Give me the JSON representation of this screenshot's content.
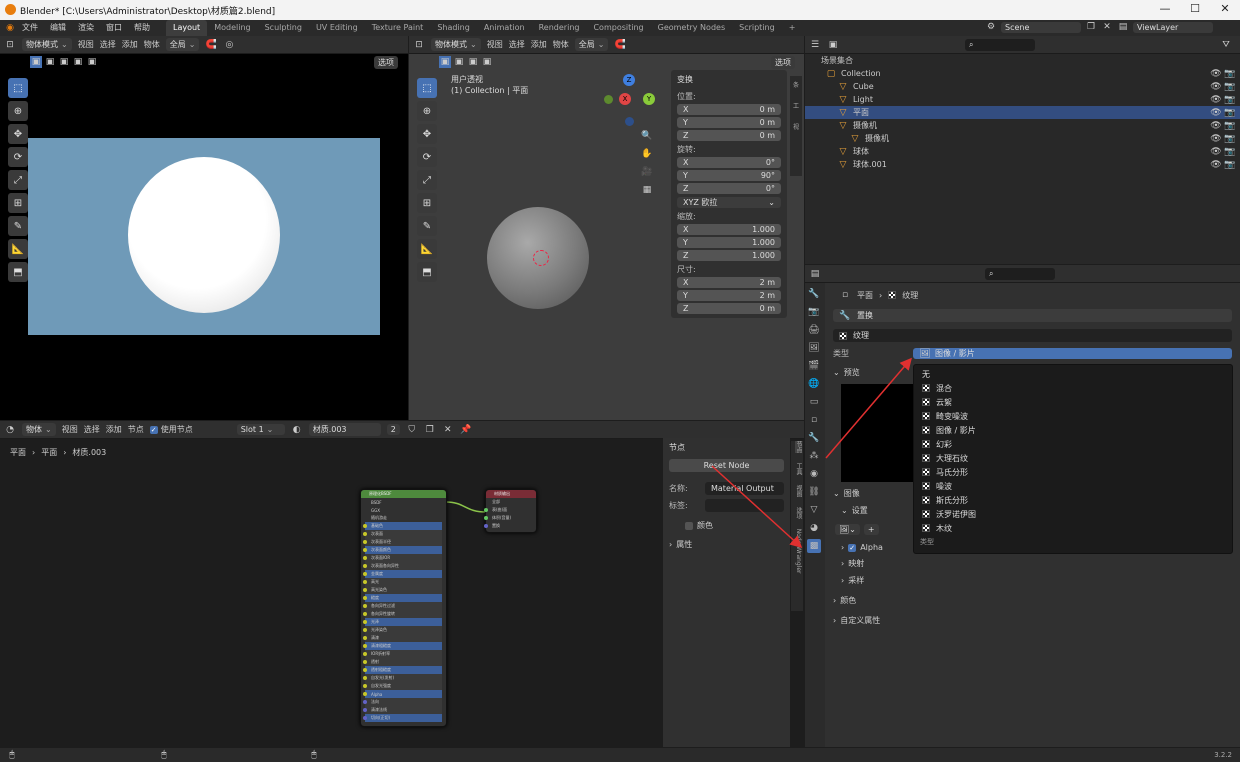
{
  "window": {
    "title": "Blender* [C:\\Users\\Administrator\\Desktop\\材质篇2.blend]",
    "minimize": "—",
    "maximize": "☐",
    "close": "✕"
  },
  "menu": [
    "文件",
    "编辑",
    "渲染",
    "窗口",
    "帮助"
  ],
  "workspaces": [
    "Layout",
    "Modeling",
    "Sculpting",
    "UV Editing",
    "Texture Paint",
    "Shading",
    "Animation",
    "Rendering",
    "Compositing",
    "Geometry Nodes",
    "Scripting",
    "+"
  ],
  "scene": {
    "scene_name": "Scene",
    "view_layer": "ViewLayer"
  },
  "viewport_left": {
    "mode": "物体模式",
    "menus": [
      "视图",
      "选择",
      "添加",
      "物体"
    ],
    "transform": "全局",
    "options": "选项"
  },
  "viewport_right": {
    "mode": "物体模式",
    "menus": [
      "视图",
      "选择",
      "添加",
      "物体"
    ],
    "transform": "全局",
    "options": "选项",
    "view_name": "用户透视",
    "collection_label": "(1) Collection | 平面",
    "axis_x": "X",
    "axis_y": "Y",
    "axis_z": "Z"
  },
  "n_panel": {
    "title": "变换",
    "location_label": "位置:",
    "location": [
      {
        "axis": "X",
        "value": "0 m"
      },
      {
        "axis": "Y",
        "value": "0 m"
      },
      {
        "axis": "Z",
        "value": "0 m"
      }
    ],
    "rotation_label": "旋转:",
    "rotation": [
      {
        "axis": "X",
        "value": "0°"
      },
      {
        "axis": "Y",
        "value": "90°"
      },
      {
        "axis": "Z",
        "value": "0°"
      }
    ],
    "rotation_mode": "XYZ 欧拉",
    "scale_label": "缩放:",
    "scale": [
      {
        "axis": "X",
        "value": "1.000"
      },
      {
        "axis": "Y",
        "value": "1.000"
      },
      {
        "axis": "Z",
        "value": "1.000"
      }
    ],
    "dimensions_label": "尺寸:",
    "dimensions": [
      {
        "axis": "X",
        "value": "2 m"
      },
      {
        "axis": "Y",
        "value": "2 m"
      },
      {
        "axis": "Z",
        "value": "0 m"
      }
    ]
  },
  "outliner": {
    "root": "场景集合",
    "items": [
      {
        "label": "Collection",
        "indent": 1
      },
      {
        "label": "Cube",
        "indent": 2
      },
      {
        "label": "Light",
        "indent": 2
      },
      {
        "label": "平面",
        "indent": 2,
        "selected": true
      },
      {
        "label": "摄像机",
        "indent": 2
      },
      {
        "label": "摄像机",
        "indent": 3
      },
      {
        "label": "球体",
        "indent": 2
      },
      {
        "label": "球体.001",
        "indent": 2
      }
    ]
  },
  "node_editor": {
    "mode": "物体",
    "menus": [
      "视图",
      "选择",
      "添加",
      "节点"
    ],
    "use_nodes": "使用节点",
    "slot": "Slot 1",
    "material": "材质.003",
    "users": "2",
    "breadcrumb": [
      "平面",
      "平面",
      "材质.003"
    ]
  },
  "node_sidebar": {
    "title": "节点",
    "reset": "Reset Node",
    "name_label": "名称:",
    "name_value": "Material Output",
    "label_label": "标签:",
    "color_label": "颜色",
    "props_label": "属性",
    "tabs": [
      "节点",
      "工具",
      "视图",
      "选项",
      "Node Wrangler"
    ]
  },
  "properties": {
    "breadcrumb": [
      "平面",
      "纹理"
    ],
    "displace": "置换",
    "texture_name": "纹理",
    "type_label": "类型",
    "type_value": "图像 / 影片",
    "preview_label": "预览",
    "image_label": "图像",
    "settings_label": "设置",
    "alpha_label": "Alpha",
    "mapping_label": "映射",
    "sampling_label": "采样",
    "colors_label": "颜色",
    "custom_label": "自定义属性"
  },
  "texture_menu": {
    "items": [
      "无",
      "混合",
      "云絮",
      "畸变噪波",
      "图像 / 影片",
      "幻彩",
      "大理石纹",
      "马氏分形",
      "噪波",
      "斯氏分形",
      "沃罗诺伊图",
      "木纹"
    ],
    "footer": "类型"
  },
  "node_labels": {
    "bsdf_title": "原理化BSDF",
    "output_title": "材质输出",
    "bsdf_rows": [
      "BSDF",
      "GGX",
      "随机游走",
      "基础色",
      "次表面",
      "次表面半径",
      "次表面颜色",
      "次表面IOR",
      "次表面各向异性",
      "金属度",
      "高光",
      "高光染色",
      "糙度",
      "各向异性过滤",
      "各向异性旋转",
      "光泽",
      "光泽染色",
      "清漆",
      "清漆粗糙度",
      "IOR折射率",
      "透射",
      "透射粗糙度",
      "自发光(发射)",
      "自发光强度",
      "Alpha",
      "法向",
      "清漆法线",
      "切向(正切)"
    ],
    "output_rows": [
      "全部",
      "表(曲)面",
      "体积(音量)",
      "置换"
    ]
  },
  "status": {
    "version": "3.2.2"
  },
  "colors": {
    "accent": "#4772b3",
    "render_bg": "#6f9ab8",
    "bsdf_header": "#4e8a3d",
    "output_header": "#7a2c36"
  }
}
